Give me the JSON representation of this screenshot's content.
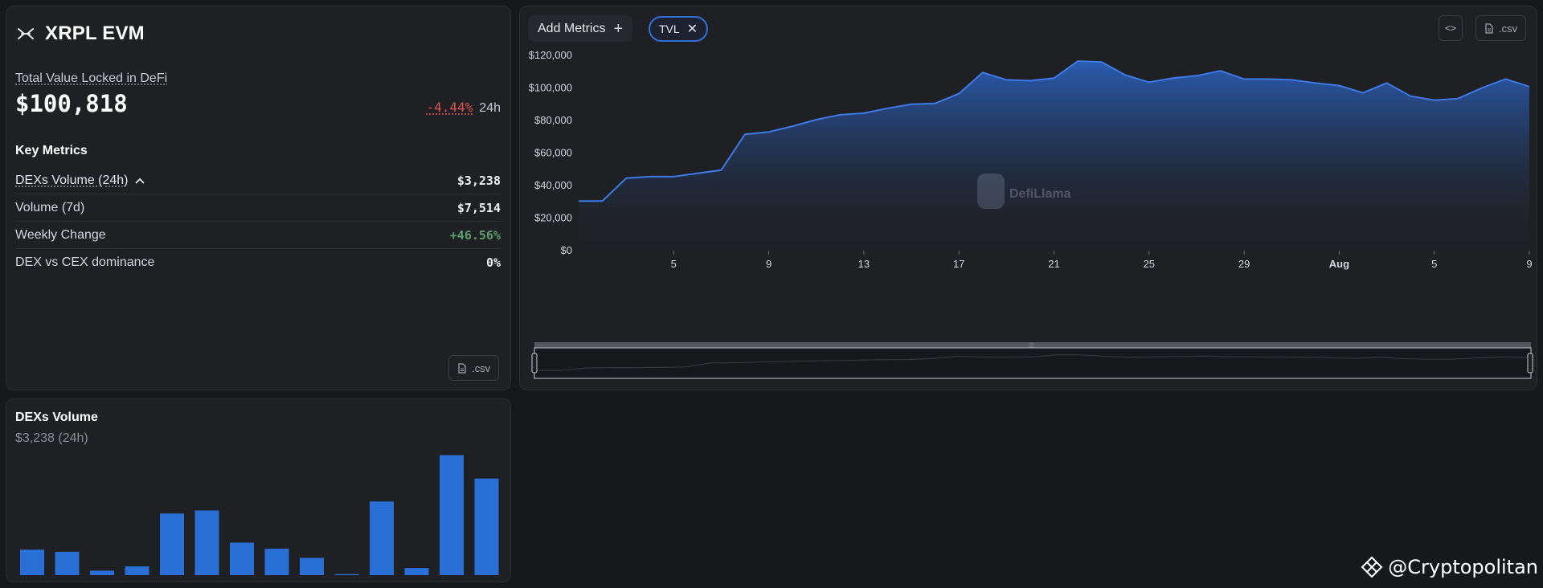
{
  "protocol": {
    "name": "XRPL EVM",
    "logo_icon": "xrpl-x-icon"
  },
  "tvl": {
    "label": "Total Value Locked in DeFi",
    "value": "$100,818",
    "change_pct": "-4.44%",
    "change_period": "24h",
    "change_color": "#e05252"
  },
  "key_metrics": {
    "title": "Key Metrics",
    "rows": [
      {
        "label": "DEXs Volume (24h)",
        "value": "$3,238"
      },
      {
        "label": "Volume (7d)",
        "value": "$7,514"
      },
      {
        "label": "Weekly Change",
        "value": "+46.56%",
        "color": "#5b9e6b"
      },
      {
        "label": "DEX vs CEX dominance",
        "value": "0%"
      }
    ]
  },
  "csv_label": ".csv",
  "dex_volume": {
    "title": "DEXs Volume",
    "subtitle": "$3,238 (24h)",
    "bar_color": "#2a6fd6"
  },
  "toolbar": {
    "add_metrics_label": "Add Metrics",
    "add_icon": "plus-icon",
    "metric_chip": "TVL",
    "remove_icon": "close-icon",
    "embed_label": "<>",
    "csv_label": ".csv"
  },
  "chart_watermark": "DefiLlama",
  "footer_brand": "@Cryptopolitan",
  "colors": {
    "accent": "#2f6fd6",
    "area_top": "#2a5fb8",
    "line": "#3d7ae6",
    "background": "#17181c",
    "panel": "#1f2024"
  },
  "chart_data": [
    {
      "type": "area",
      "title": "",
      "series": [
        {
          "name": "TVL",
          "values": [
            30500,
            30500,
            44500,
            45500,
            45500,
            47500,
            49500,
            71500,
            73000,
            76500,
            80500,
            83500,
            84500,
            87500,
            90000,
            90500,
            96500,
            109500,
            105000,
            104500,
            106000,
            116500,
            116000,
            108000,
            103500,
            106000,
            107500,
            110500,
            105500,
            105500,
            105000,
            103000,
            101500,
            97000,
            103000,
            95000,
            92500,
            93500,
            100000,
            105500,
            100818
          ]
        }
      ],
      "x_labels": [
        "5",
        "9",
        "13",
        "17",
        "21",
        "25",
        "29",
        "Aug",
        "5",
        "9"
      ],
      "x_label_indices": [
        4,
        8,
        12,
        16,
        20,
        24,
        28,
        32,
        36,
        40
      ],
      "y_ticks": [
        "$0",
        "$20,000",
        "$40,000",
        "$60,000",
        "$80,000",
        "$100,000",
        "$120,000"
      ],
      "ylim": [
        0,
        120000
      ],
      "xlabel": "",
      "ylabel": "",
      "grid": false
    },
    {
      "type": "bar",
      "title": "DEXs Volume",
      "values": [
        1250,
        1150,
        220,
        430,
        3030,
        3180,
        1600,
        1300,
        850,
        50,
        3620,
        350,
        5900,
        4750
      ],
      "ylim": [
        0,
        6200
      ],
      "xlabel": "",
      "ylabel": ""
    }
  ]
}
